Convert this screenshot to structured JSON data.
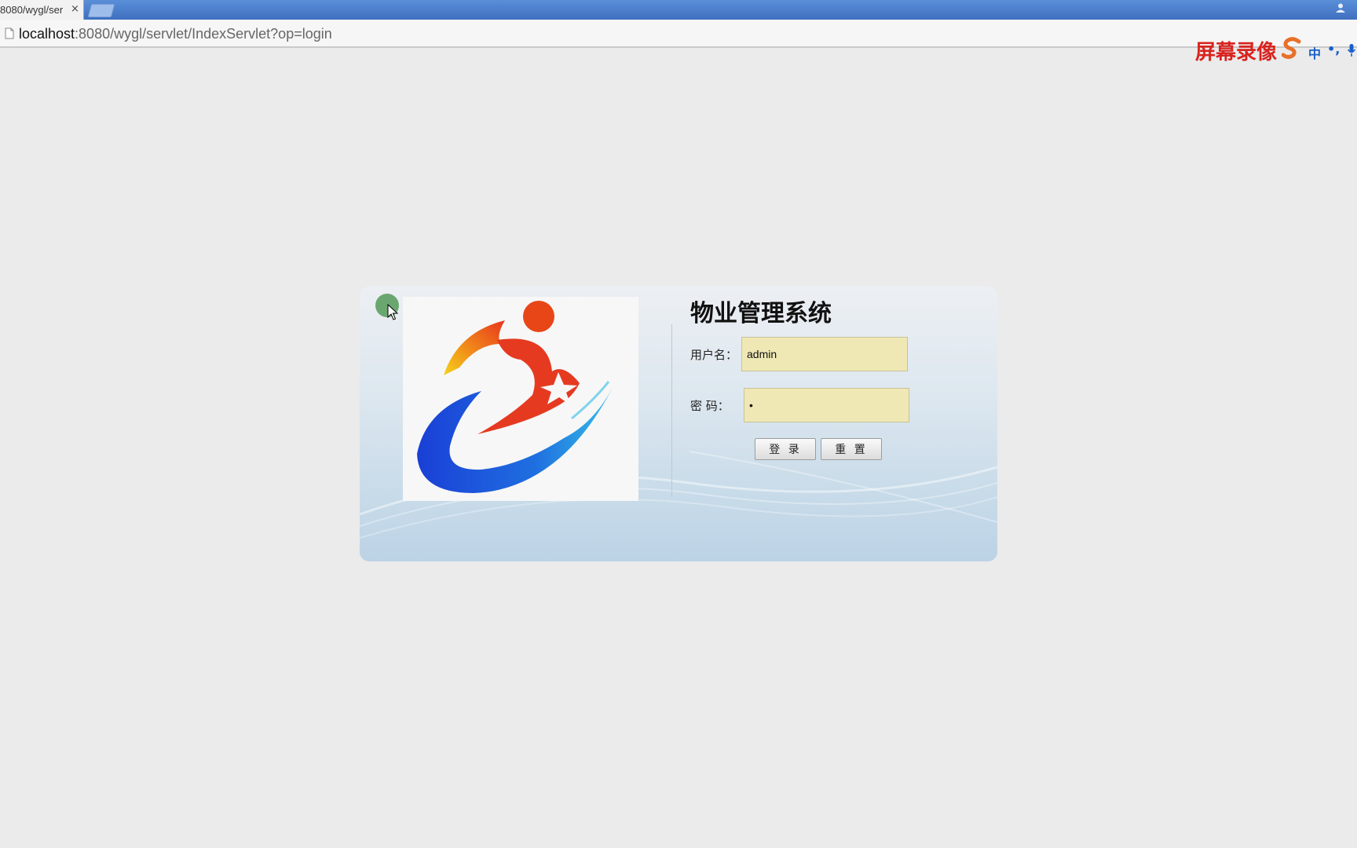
{
  "browser": {
    "tab_title": "8080/wygl/ser",
    "tab_close": "×",
    "url_host": "localhost",
    "url_rest": ":8080/wygl/servlet/IndexServlet?op=login"
  },
  "overlay": {
    "recorder_label": "屏幕录像",
    "ime_mode": "中",
    "ime_punct": "•,"
  },
  "login": {
    "title": "物业管理系统",
    "username_label": "用户名：",
    "username_value": "admin",
    "password_label": "密    码：",
    "password_value": "•",
    "login_button": "登 录",
    "reset_button": "重 置"
  },
  "colors": {
    "input_bg": "#efe8b5",
    "tab_strip": "#4a7ccb",
    "recorder_red": "#d8241f"
  },
  "icons": [
    "page-icon",
    "close-icon",
    "user-icon",
    "mic-icon",
    "mouse-cursor-icon"
  ]
}
